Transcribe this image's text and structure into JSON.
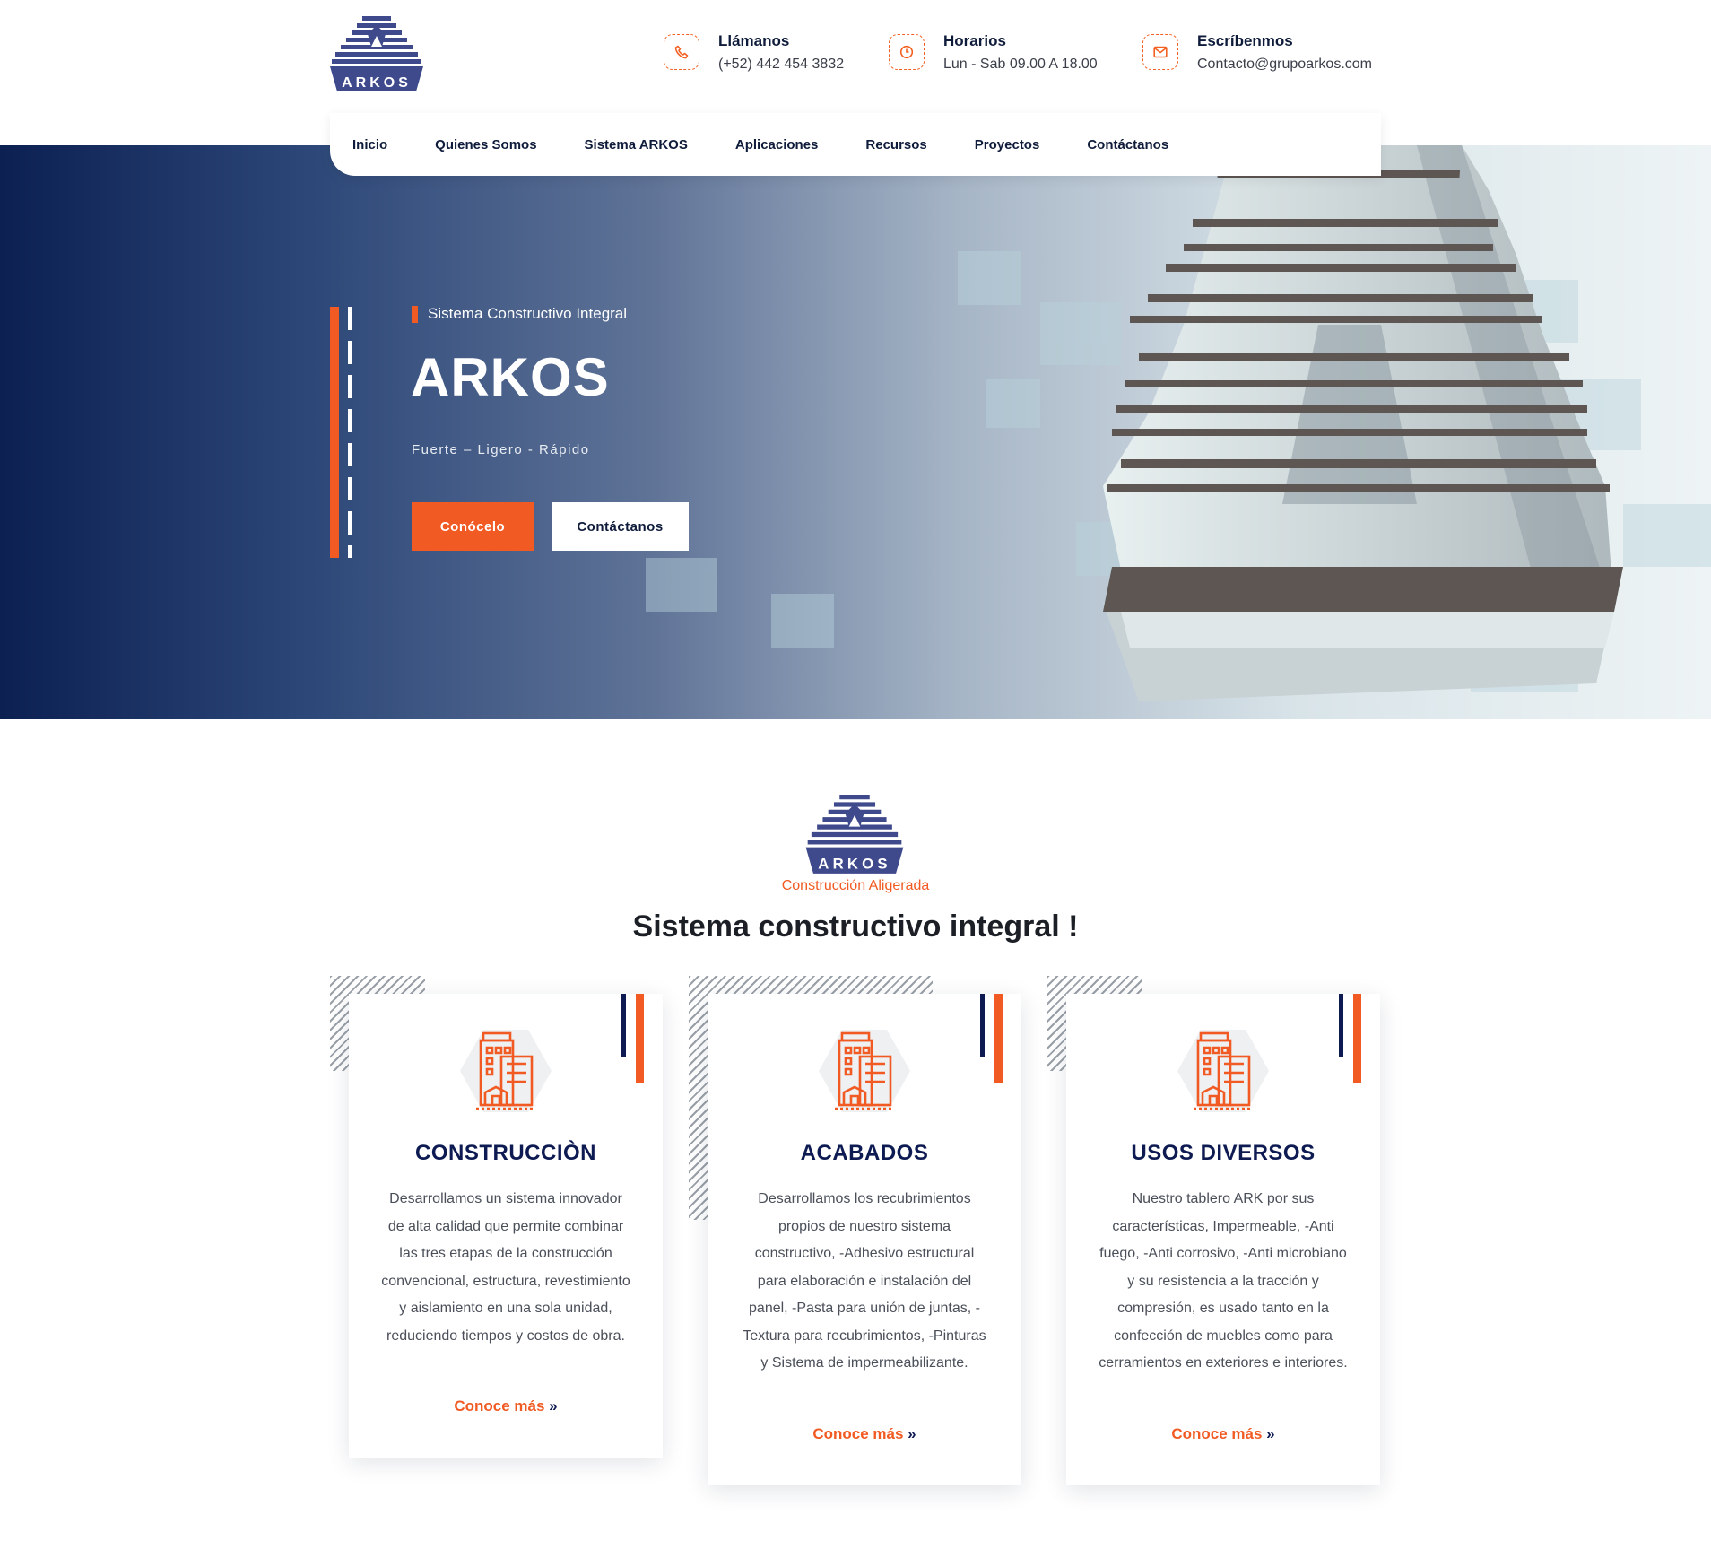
{
  "brand": {
    "logo_text": "ARKOS"
  },
  "header": {
    "contacts": [
      {
        "icon": "phone-icon",
        "title": "Llámanos",
        "value": "(+52) 442 454 3832"
      },
      {
        "icon": "clock-icon",
        "title": "Horarios",
        "value": "Lun - Sab 09.00 A 18.00"
      },
      {
        "icon": "mail-icon",
        "title": "Escríbenmos",
        "value": "Contacto@grupoarkos.com"
      }
    ]
  },
  "nav": {
    "items": [
      "Inicio",
      "Quienes Somos",
      "Sistema ARKOS",
      "Aplicaciones",
      "Recursos",
      "Proyectos",
      "Contáctanos"
    ]
  },
  "hero": {
    "tag": "Sistema Constructivo Integral",
    "title": "ARKOS",
    "subtitle": "Fuerte – Ligero - Rápido",
    "primary_button": "Conócelo",
    "secondary_button": "Contáctanos"
  },
  "section": {
    "logo_text": "ARKOS",
    "tagline": "Construcción Aligerada",
    "title": "Sistema constructivo integral !"
  },
  "cards": [
    {
      "icon": "building-icon",
      "title": "CONSTRUCCIÒN",
      "text": "Desarrollamos un sistema innovador de alta calidad que permite combinar las tres etapas de la construcción convencional, estructura, revestimiento y aislamiento en una sola unidad, reduciendo tiempos y costos de obra.",
      "link": "Conoce más",
      "link_chev": "»"
    },
    {
      "icon": "building-icon",
      "title": "ACABADOS",
      "text": "Desarrollamos los recubrimientos propios de nuestro sistema constructivo, -Adhesivo estructural para elaboración e instalación del panel, -Pasta para unión de juntas, -Textura para recubrimientos, -Pinturas y Sistema de impermeabilizante.",
      "link": "Conoce más",
      "link_chev": "»"
    },
    {
      "icon": "building-icon",
      "title": "USOS DIVERSOS",
      "text": "Nuestro tablero ARK por sus características, Impermeable, -Anti fuego, -Anti corrosivo, -Anti microbiano y su resistencia a la tracción y compresión, es usado tanto en la confección de muebles como para cerramientos en exteriores e interiores.",
      "link": "Conoce más",
      "link_chev": "»"
    }
  ],
  "colors": {
    "accent": "#f15a22",
    "navy": "#0e1b52",
    "logo_blue": "#3f4a8c"
  }
}
